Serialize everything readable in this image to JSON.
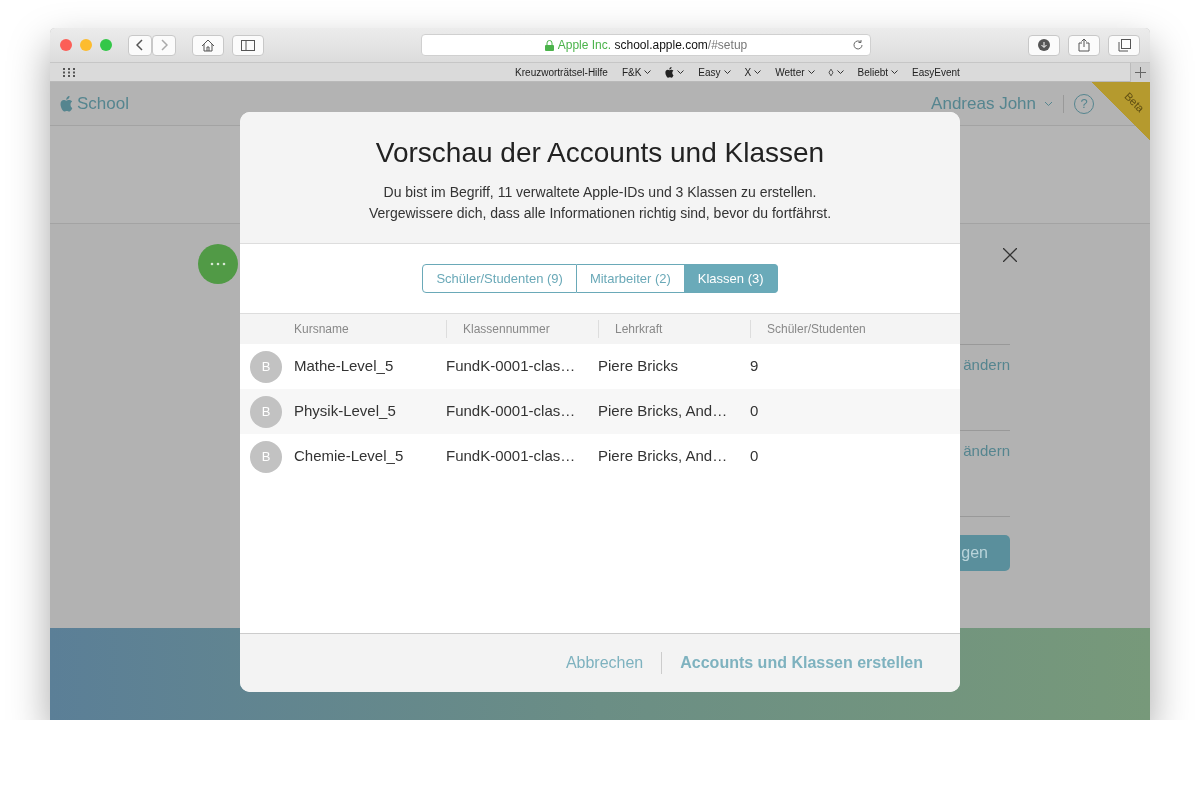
{
  "browser": {
    "address": {
      "org": "Apple Inc.",
      "domain": "school.apple.com",
      "path": "/#setup"
    },
    "bookmarks": [
      {
        "kind": "text",
        "label": "Kreuzworträtsel-Hilfe",
        "dropdown": false
      },
      {
        "kind": "text",
        "label": "F&K",
        "dropdown": true
      },
      {
        "kind": "apple",
        "dropdown": true
      },
      {
        "kind": "text",
        "label": "Easy",
        "dropdown": true
      },
      {
        "kind": "text",
        "label": "X",
        "dropdown": true
      },
      {
        "kind": "text",
        "label": "Wetter",
        "dropdown": true
      },
      {
        "kind": "text",
        "label": "◊",
        "dropdown": true
      },
      {
        "kind": "text",
        "label": "Beliebt",
        "dropdown": true
      },
      {
        "kind": "text",
        "label": "EasyEvent",
        "dropdown": false
      }
    ]
  },
  "page": {
    "logo_text": "School",
    "user_name": "Andreas John",
    "ribbon": "Beta",
    "help": "?",
    "links": [
      "ändern",
      "ändern"
    ],
    "button": "gen"
  },
  "modal": {
    "title": "Vorschau der Accounts und Klassen",
    "description": [
      "Du bist im Begriff, 11 verwaltete Apple-IDs und 3 Klassen zu erstellen.",
      "Vergewissere dich, dass alle Informationen richtig sind, bevor du fortfährst."
    ],
    "tabs": [
      {
        "label": "Schüler/Studenten (9)",
        "selected": false
      },
      {
        "label": "Mitarbeiter (2)",
        "selected": false
      },
      {
        "label": "Klassen (3)",
        "selected": true
      }
    ],
    "columns": [
      "Kursname",
      "Klassennummer",
      "Lehrkraft",
      "Schüler/Studenten"
    ],
    "rows": [
      {
        "avatar": "B",
        "cells": [
          "Mathe-Level_5",
          "FundK-0001-clas…",
          "Piere Bricks",
          "9"
        ]
      },
      {
        "avatar": "B",
        "cells": [
          "Physik-Level_5",
          "FundK-0001-clas…",
          "Piere Bricks, And…",
          "0"
        ]
      },
      {
        "avatar": "B",
        "cells": [
          "Chemie-Level_5",
          "FundK-0001-clas…",
          "Piere Bricks, And…",
          "0"
        ]
      }
    ],
    "cancel": "Abbrechen",
    "confirm": "Accounts und Klassen erstellen"
  }
}
